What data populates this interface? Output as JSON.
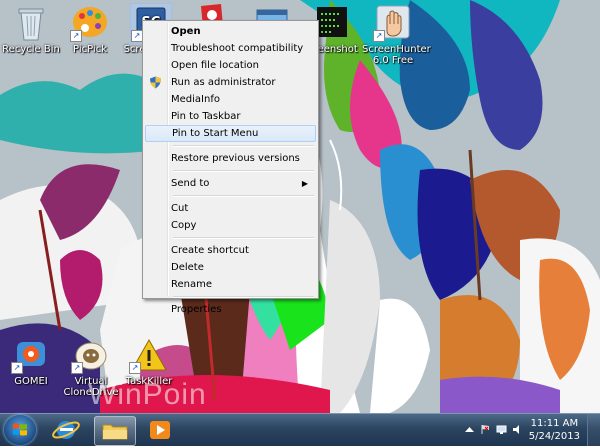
{
  "desktop_icons": [
    {
      "id": "recycle-bin",
      "label": "Recycle Bin",
      "icon": "recycle-bin-icon"
    },
    {
      "id": "picpick",
      "label": "PicPick",
      "icon": "picpick-icon"
    },
    {
      "id": "screen-grab",
      "label": "Screen G...",
      "icon": "screen-capture-icon"
    },
    {
      "id": "app-red",
      "label": "",
      "icon": "red-app-icon"
    },
    {
      "id": "app-window",
      "label": "",
      "icon": "window-app-icon"
    },
    {
      "id": "screenshot",
      "label": "...reenshot",
      "icon": "screenshot-app-icon"
    },
    {
      "id": "screenhunter",
      "label": "ScreenHunter 6.0 Free",
      "icon": "hand-pointer-icon"
    },
    {
      "id": "gomei",
      "label": "GOMEI",
      "icon": "gomei-icon"
    },
    {
      "id": "virtual-clone",
      "label": "Virtual CloneDrive",
      "icon": "sheep-icon"
    },
    {
      "id": "taskkiller",
      "label": "TaskKiller",
      "icon": "warning-icon"
    }
  ],
  "context_menu": {
    "items": [
      {
        "label": "Open",
        "bold": true
      },
      {
        "label": "Troubleshoot compatibility"
      },
      {
        "label": "Open file location"
      },
      {
        "label": "Run as administrator",
        "icon": "uac-shield-icon"
      },
      {
        "label": "MediaInfo"
      },
      {
        "label": "Pin to Taskbar"
      },
      {
        "label": "Pin to Start Menu",
        "hover": true
      },
      {
        "separator": true
      },
      {
        "label": "Restore previous versions"
      },
      {
        "separator": true
      },
      {
        "label": "Send to",
        "submenu": true
      },
      {
        "separator": true
      },
      {
        "label": "Cut"
      },
      {
        "label": "Copy"
      },
      {
        "separator": true
      },
      {
        "label": "Create shortcut"
      },
      {
        "label": "Delete"
      },
      {
        "label": "Rename"
      },
      {
        "separator": true
      },
      {
        "label": "Properties"
      }
    ]
  },
  "taskbar": {
    "pinned": [
      {
        "id": "ie",
        "icon": "internet-explorer-icon"
      },
      {
        "id": "explorer",
        "icon": "folder-icon",
        "active": true
      },
      {
        "id": "media-player",
        "icon": "media-player-icon"
      }
    ],
    "clock": {
      "time": "11:11 AM",
      "date": "5/24/2013"
    }
  },
  "watermark": "WinPoin",
  "colors": {
    "taskbar": "#2b4460",
    "menu_bg": "#f0f0f0",
    "menu_hover": "#dbe8f8"
  }
}
